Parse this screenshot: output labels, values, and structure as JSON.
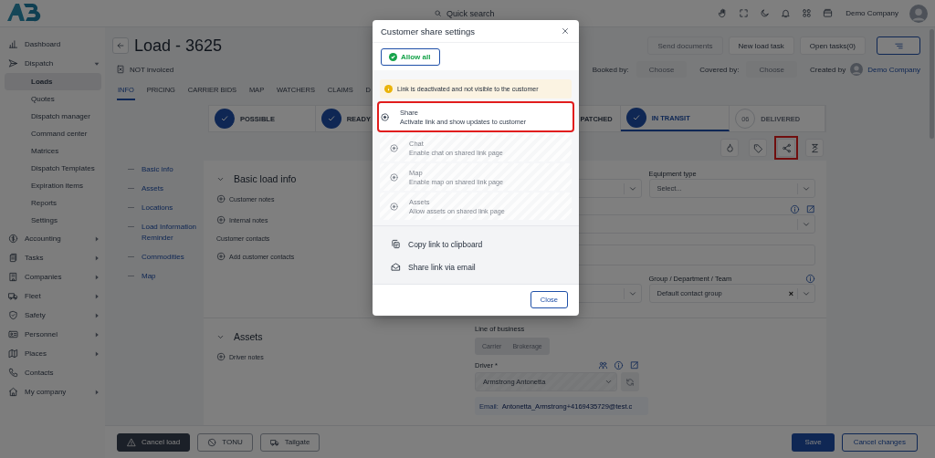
{
  "header": {
    "search_placeholder": "Quick search",
    "user_name": "Demo Company"
  },
  "sidebar": {
    "items": [
      {
        "label": "Dashboard",
        "kind": "link"
      },
      {
        "label": "Dispatch",
        "kind": "group",
        "expanded": true,
        "children": [
          {
            "label": "Loads",
            "selected": true
          },
          {
            "label": "Quotes",
            "selected": false
          },
          {
            "label": "Dispatch manager",
            "selected": false
          },
          {
            "label": "Command center",
            "selected": false
          },
          {
            "label": "Matrices",
            "selected": false
          },
          {
            "label": "Dispatch Templates",
            "selected": false
          },
          {
            "label": "Expiration items",
            "selected": false
          },
          {
            "label": "Reports",
            "selected": false
          },
          {
            "label": "Settings",
            "selected": false
          }
        ]
      },
      {
        "label": "Accounting",
        "kind": "group",
        "expanded": false
      },
      {
        "label": "Tasks",
        "kind": "group",
        "expanded": false
      },
      {
        "label": "Companies",
        "kind": "group",
        "expanded": false
      },
      {
        "label": "Fleet",
        "kind": "group",
        "expanded": false
      },
      {
        "label": "Safety",
        "kind": "group",
        "expanded": false
      },
      {
        "label": "Personnel",
        "kind": "group",
        "expanded": false
      },
      {
        "label": "Places",
        "kind": "group",
        "expanded": false
      },
      {
        "label": "Contacts",
        "kind": "link"
      },
      {
        "label": "My company",
        "kind": "group",
        "expanded": false
      }
    ]
  },
  "load": {
    "title": "Load - 3625",
    "invoice_status": "NOT invoiced",
    "actions": [
      "Send documents",
      "New load task",
      "Open tasks(0)"
    ],
    "assignments": [
      {
        "label": "Booked by:",
        "value": "Choose"
      },
      {
        "label": "Covered by:",
        "value": "Choose"
      }
    ],
    "created_by": {
      "label": "Created by",
      "value": "Demo Company"
    }
  },
  "tabs": [
    {
      "label": "INFO",
      "selected": true
    },
    {
      "label": "PRICING",
      "selected": false
    },
    {
      "label": "CARRIER BIDS",
      "selected": false
    },
    {
      "label": "MAP",
      "selected": false
    },
    {
      "label": "WATCHERS",
      "selected": false
    },
    {
      "label": "CLAIMS",
      "selected": false
    },
    {
      "label": "D",
      "selected": false
    }
  ],
  "steps": [
    {
      "label": "POSSIBLE",
      "checked": true,
      "selected": false
    },
    {
      "label": "READY",
      "checked": true,
      "selected": false
    },
    {
      "label": "PATCHED",
      "selected": false
    },
    {
      "label": "IN TRANSIT",
      "checked": true,
      "selected": true
    },
    {
      "label": "DELIVERED",
      "checked": false,
      "selected": false,
      "number": "06"
    }
  ],
  "toolbar": [
    {
      "highlighted": false
    },
    {
      "highlighted": false
    },
    {
      "highlighted": true
    },
    {
      "highlighted": false
    }
  ],
  "side_nav": [
    "Basic info",
    "Assets",
    "Locations",
    "Load Information Reminder",
    "Commodities",
    "Map"
  ],
  "sections": [
    {
      "title": "Basic load info",
      "items": [
        {
          "kind": "add",
          "label": "Customer notes"
        },
        {
          "kind": "add",
          "label": "Internal notes"
        },
        {
          "kind": "heading",
          "label": "Customer contacts"
        },
        {
          "kind": "add",
          "label": "Add customer contacts"
        }
      ]
    },
    {
      "title": "Assets",
      "items": [
        {
          "kind": "add",
          "label": "Driver notes"
        }
      ]
    }
  ],
  "basic_form": {
    "equipment_type": {
      "label": "Equipment type",
      "placeholder": "Select..."
    },
    "group": {
      "label": "Group / Department / Team",
      "value": "Default contact group",
      "clear": "×"
    }
  },
  "assets_form": {
    "line_of_business": {
      "label": "Line of business",
      "options": [
        {
          "label": "Carrier",
          "selected": false
        },
        {
          "label": "Brokerage",
          "selected": false
        }
      ]
    },
    "driver": {
      "label": "Driver *",
      "value": "Armstrong Antonetta",
      "email_label": "Email:",
      "email": "Antonetta_Armstrong+4169435729@test.c"
    }
  },
  "footer": {
    "left": [
      "Cancel load",
      "TONU",
      "Tailgate"
    ],
    "save": "Save",
    "cancel": "Cancel changes"
  },
  "modal": {
    "title": "Customer share settings",
    "allow_all": "Allow all",
    "notice": "Link is deactivated and not visible to the customer",
    "options": [
      {
        "title": "Share",
        "description": "Activate link and show updates to customer",
        "disabled": false,
        "highlighted": true
      },
      {
        "title": "Chat",
        "description": "Enable chat on shared link page",
        "disabled": true,
        "highlighted": false
      },
      {
        "title": "Map",
        "description": "Enable map on shared link page",
        "disabled": true,
        "highlighted": false
      },
      {
        "title": "Assets",
        "description": "Allow assets on shared link page",
        "disabled": true,
        "highlighted": false
      }
    ],
    "actions": [
      "Copy link to clipboard",
      "Share link via email"
    ],
    "close": "Close"
  }
}
